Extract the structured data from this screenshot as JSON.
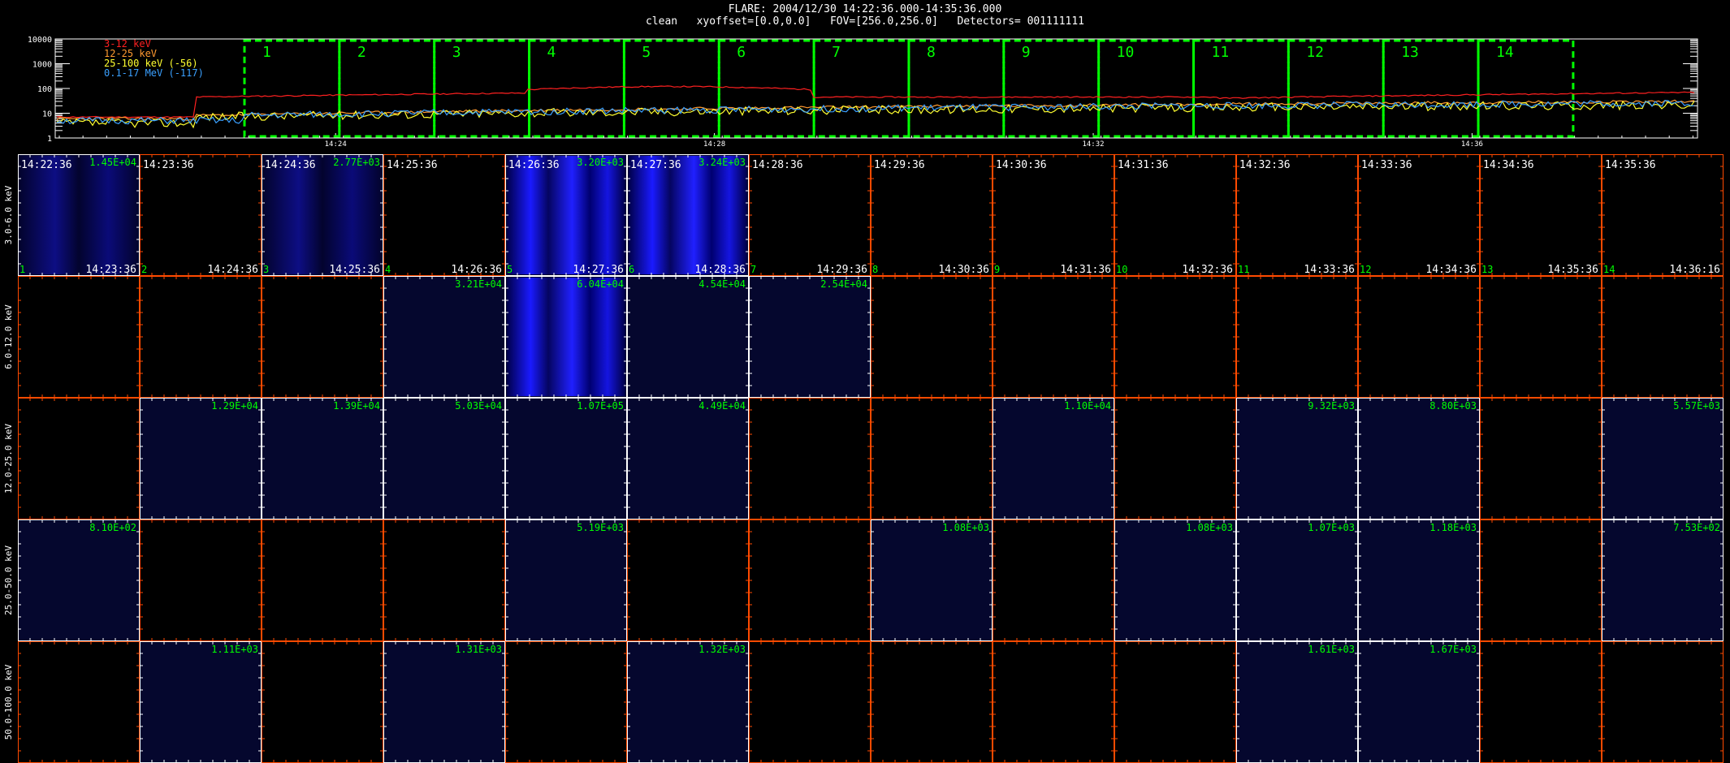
{
  "header": {
    "line1": "FLARE: 2004/12/30 14:22:36.000-14:35:36.000",
    "line2": "clean   xyoffset=[0.0,0.0]   FOV=[256.0,256.0]   Detectors= 001111111"
  },
  "colors": {
    "bg": "#000000",
    "axis": "#ffffff",
    "panel_axis_red": "#ff4a00",
    "green": "#00ff00",
    "blue_signal": "#1a1aff",
    "dark_blue": "#080a3c"
  },
  "lightcurve": {
    "yticks": [
      "10000",
      "1000",
      "100",
      "10",
      "1"
    ],
    "xticks": [
      "14:24",
      "14:28",
      "14:32",
      "14:36"
    ],
    "legend": [
      {
        "text": "3-12 keV",
        "color": "#ff2020"
      },
      {
        "text": "12-25 keV",
        "color": "#ff9a30"
      },
      {
        "text": "25-100 keV (-56)",
        "color": "#ffff30"
      },
      {
        "text": "0.1-17 MeV (-117)",
        "color": "#3aa0ff"
      }
    ],
    "intervals": [
      "1",
      "2",
      "3",
      "4",
      "5",
      "6",
      "7",
      "8",
      "9",
      "10",
      "11",
      "12",
      "13",
      "14"
    ]
  },
  "chart_data": {
    "type": "heatmap",
    "energy_bands": [
      "3.0-6.0 keV",
      "6.0-12.0 keV",
      "12.0-25.0 keV",
      "25.0-50.0 keV",
      "50.0-100.0 keV"
    ],
    "time_start": [
      "14:22:36",
      "14:23:36",
      "14:24:36",
      "14:25:36",
      "14:26:36",
      "14:27:36",
      "14:28:36",
      "14:29:36",
      "14:30:36",
      "14:31:36",
      "14:32:36",
      "14:33:36",
      "14:34:36",
      "14:35:36"
    ],
    "time_end": [
      "14:23:36",
      "14:24:36",
      "14:25:36",
      "14:26:36",
      "14:27:36",
      "14:28:36",
      "14:29:36",
      "14:30:36",
      "14:31:36",
      "14:32:36",
      "14:33:36",
      "14:34:36",
      "14:35:36",
      "14:36:16"
    ],
    "interval_numbers": [
      "1",
      "2",
      "3",
      "4",
      "5",
      "6",
      "7",
      "8",
      "9",
      "10",
      "11",
      "12",
      "13",
      "14"
    ],
    "peak_values": [
      [
        "1.45E+04",
        "",
        "2.77E+03",
        "",
        "3.20E+03",
        "3.24E+03",
        "",
        "",
        "",
        "",
        "",
        "",
        "",
        ""
      ],
      [
        "",
        "",
        "",
        "3.21E+04",
        "6.04E+04",
        "4.54E+04",
        "2.54E+04",
        "",
        "",
        "",
        "",
        "",
        "",
        ""
      ],
      [
        "",
        "1.29E+04",
        "1.39E+04",
        "5.03E+04",
        "1.07E+05",
        "4.49E+04",
        "",
        "",
        "1.10E+04",
        "",
        "9.32E+03",
        "8.80E+03",
        "",
        "5.57E+03"
      ],
      [
        "8.10E+02",
        "",
        "",
        "",
        "5.19E+03",
        "",
        "",
        "1.08E+03",
        "",
        "1.08E+03",
        "1.07E+03",
        "1.18E+03",
        "",
        "7.53E+02"
      ],
      [
        "",
        "1.11E+03",
        "",
        "1.31E+03",
        "",
        "1.32E+03",
        "",
        "",
        "",
        "",
        "1.61E+03",
        "1.67E+03",
        "",
        ""
      ]
    ]
  }
}
